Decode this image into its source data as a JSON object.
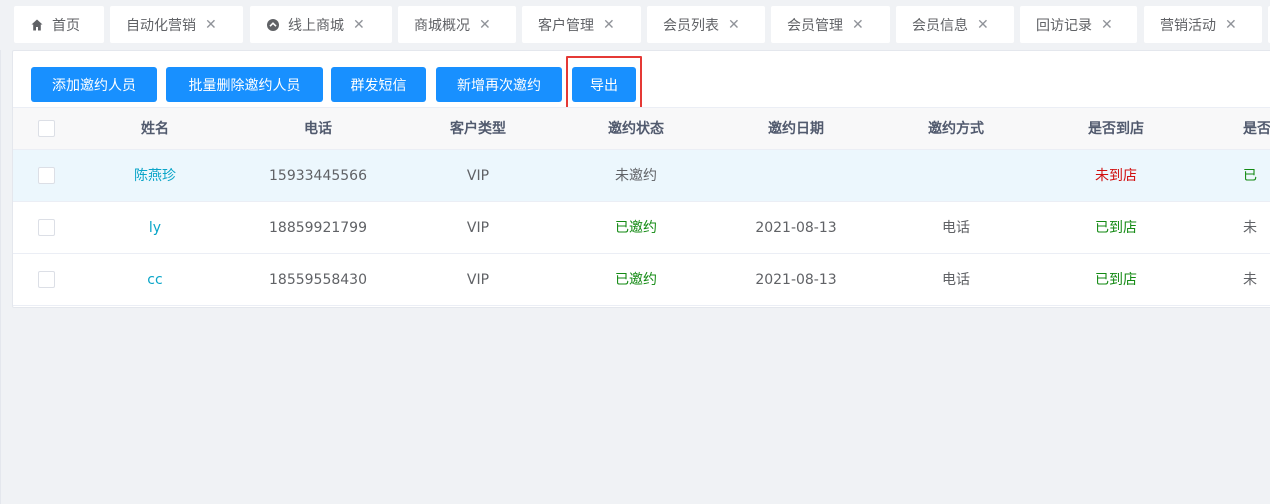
{
  "tabs": [
    {
      "label": "首页",
      "icon": "home-icon",
      "closable": false
    },
    {
      "label": "自动化营销",
      "closable": true
    },
    {
      "label": "线上商城",
      "icon": "circle-arrow-icon",
      "closable": true
    },
    {
      "label": "商城概况",
      "closable": true
    },
    {
      "label": "客户管理",
      "closable": true
    },
    {
      "label": "会员列表",
      "closable": true
    },
    {
      "label": "会员管理",
      "closable": true
    },
    {
      "label": "会员信息",
      "closable": true
    },
    {
      "label": "回访记录",
      "closable": true
    },
    {
      "label": "营销活动",
      "closable": true
    }
  ],
  "toolbar": {
    "add_label": "添加邀约人员",
    "batch_delete_label": "批量删除邀约人员",
    "sms_label": "群发短信",
    "reinvite_label": "新增再次邀约",
    "export_label": "导出"
  },
  "table": {
    "headers": {
      "name": "姓名",
      "phone": "电话",
      "type": "客户类型",
      "status": "邀约状态",
      "date": "邀约日期",
      "way": "邀约方式",
      "arrive": "是否到店",
      "extra": "是否"
    },
    "rows": [
      {
        "name": "陈燕珍",
        "phone": "15933445566",
        "type": "VIP",
        "status": "未邀约",
        "date": "",
        "way": "",
        "arrive": "未到店",
        "extra": "已"
      },
      {
        "name": "ly",
        "phone": "18859921799",
        "type": "VIP",
        "status": "已邀约",
        "date": "2021-08-13",
        "way": "电话",
        "arrive": "已到店",
        "extra": "未"
      },
      {
        "name": "cc",
        "phone": "18559558430",
        "type": "VIP",
        "status": "已邀约",
        "date": "2021-08-13",
        "way": "电话",
        "arrive": "已到店",
        "extra": "未"
      }
    ]
  },
  "colors": {
    "primary": "#1890ff",
    "link": "#0aa5c8",
    "success": "#138a13",
    "danger": "#d10f0f",
    "highlight": "#e53935"
  }
}
